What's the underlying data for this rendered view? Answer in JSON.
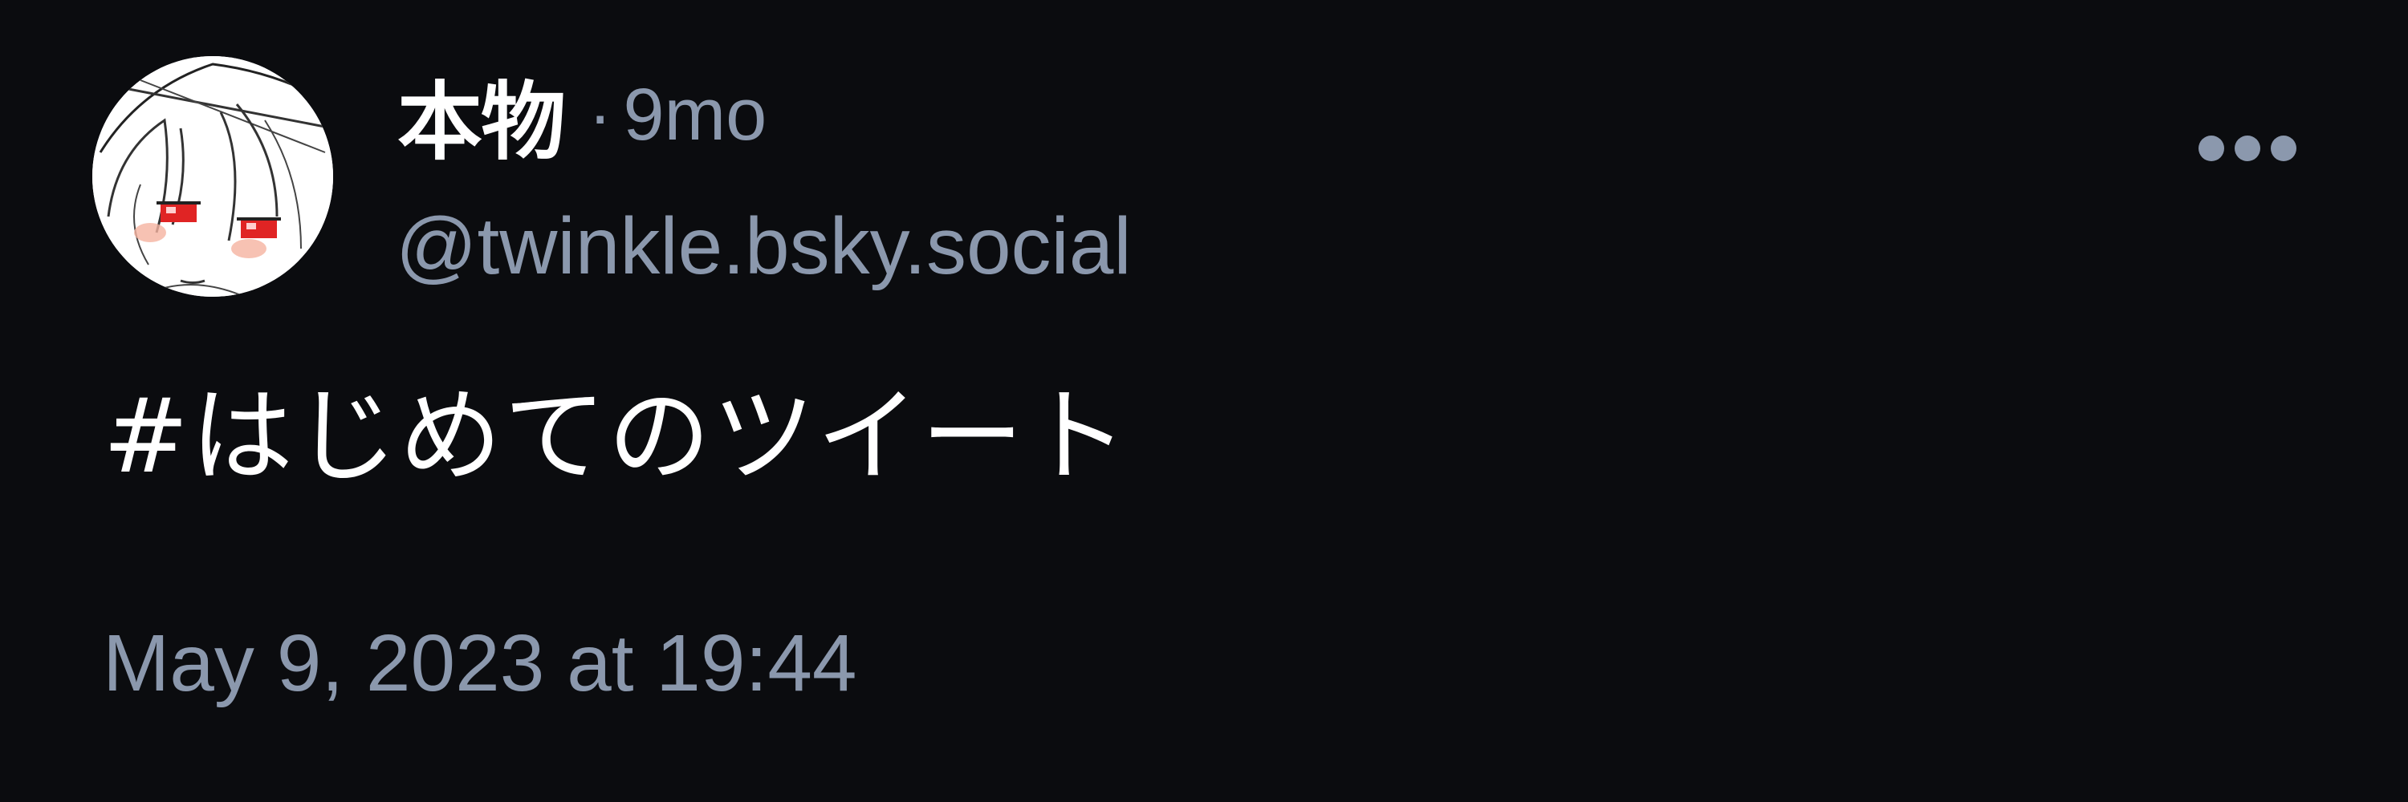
{
  "post": {
    "author": {
      "display_name": "本物",
      "separator": "·",
      "relative_time": "9mo",
      "handle": "@twinkle.bsky.social",
      "avatar_icon": "anime-character-avatar"
    },
    "menu_icon": "more-horizontal-icon",
    "text": "#はじめてのツイート",
    "timestamp": "May 9, 2023 at 19:44"
  },
  "colors": {
    "background": "#0b0c0f",
    "primary_text": "#ffffff",
    "secondary_text": "#8b98ad",
    "menu_icon": "#8b98ad"
  }
}
